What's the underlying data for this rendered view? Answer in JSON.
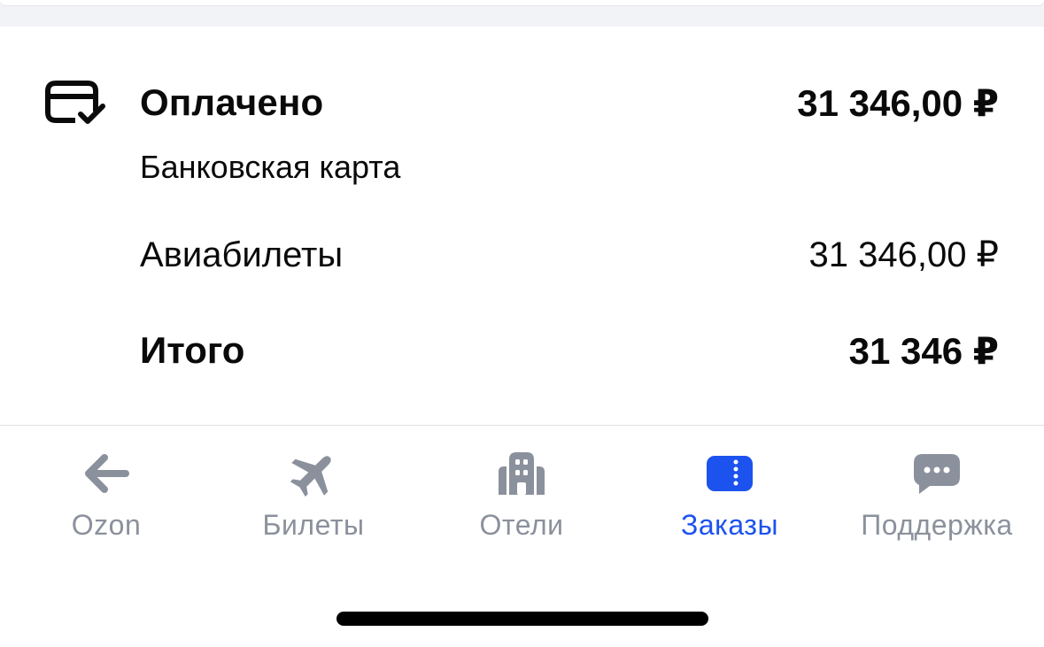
{
  "payment": {
    "status_label": "Оплачено",
    "status_amount": "31 346,00 ₽",
    "method": "Банковская карта",
    "items": [
      {
        "label": "Авиабилеты",
        "amount": "31 346,00 ₽"
      }
    ],
    "total_label": "Итого",
    "total_amount": "31 346 ₽"
  },
  "tabbar": {
    "tabs": [
      {
        "label": "Ozon",
        "icon": "arrow-left-icon",
        "active": false
      },
      {
        "label": "Билеты",
        "icon": "airplane-icon",
        "active": false
      },
      {
        "label": "Отели",
        "icon": "hotel-icon",
        "active": false
      },
      {
        "label": "Заказы",
        "icon": "ticket-icon",
        "active": true
      },
      {
        "label": "Поддержка",
        "icon": "chat-icon",
        "active": false
      }
    ]
  },
  "colors": {
    "active": "#1c53ee",
    "inactive": "#8b919c",
    "text": "#0a0a0a"
  }
}
